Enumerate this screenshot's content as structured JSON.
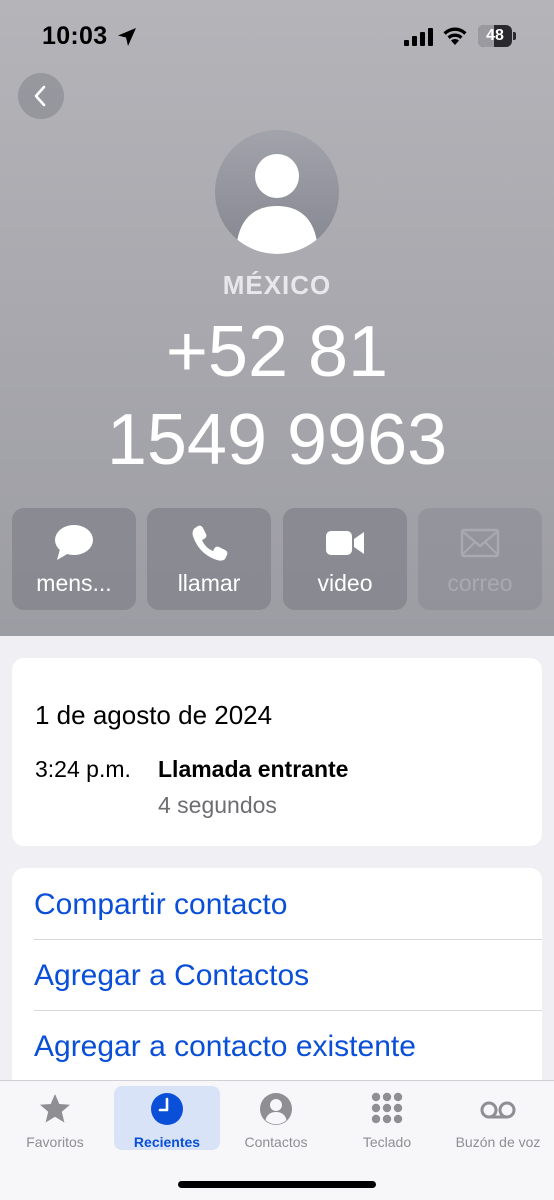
{
  "status_bar": {
    "time": "10:03",
    "battery_level": "48",
    "battery_fraction": 0.48
  },
  "contact": {
    "country": "MÉXICO",
    "phone_line_1": "+52 81",
    "phone_line_2": "1549 9963"
  },
  "actions": [
    {
      "label": "mens...",
      "icon": "message-icon",
      "enabled": true
    },
    {
      "label": "llamar",
      "icon": "phone-icon",
      "enabled": true
    },
    {
      "label": "video",
      "icon": "video-icon",
      "enabled": true
    },
    {
      "label": "correo",
      "icon": "mail-icon",
      "enabled": false
    }
  ],
  "call_log": {
    "date": "1 de agosto de 2024",
    "time": "3:24 p.m.",
    "type": "Llamada entrante",
    "duration": "4 segundos"
  },
  "options": [
    "Compartir contacto",
    "Agregar a Contactos",
    "Agregar a contacto existente"
  ],
  "tabs": [
    {
      "label": "Favoritos",
      "icon": "star-icon",
      "active": false
    },
    {
      "label": "Recientes",
      "icon": "clock-icon",
      "active": true
    },
    {
      "label": "Contactos",
      "icon": "person-circle-icon",
      "active": false
    },
    {
      "label": "Teclado",
      "icon": "keypad-icon",
      "active": false
    },
    {
      "label": "Buzón de voz",
      "icon": "voicemail-icon",
      "active": false
    }
  ],
  "colors": {
    "accent": "#0a4fd8",
    "header_bg": "#a8a8ae",
    "tab_active_bg": "#d9e3f7"
  }
}
